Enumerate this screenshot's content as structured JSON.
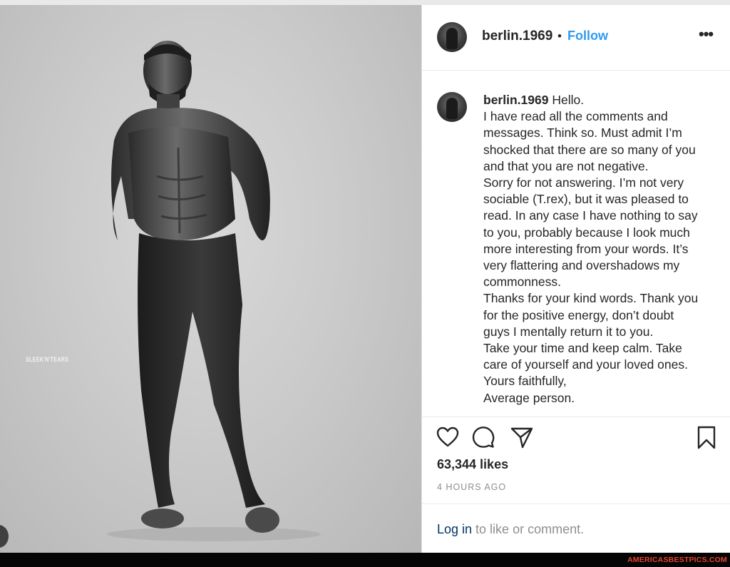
{
  "post": {
    "username": "berlin.1969",
    "separator": "•",
    "follow_label": "Follow",
    "more_label": "•••",
    "watermark": "SLEEK'N'TEARS",
    "caption_first": "Hello.",
    "caption_lines": [
      "I have read all the comments and",
      "messages. Think so. Must admit I’m",
      "shocked that there are so many of you",
      "and that you are not negative.",
      "Sorry for not answering. I’m not very",
      "sociable (T.rex), but it was pleased to",
      "read. In any case I have nothing to say",
      "to you, probably because I look much",
      "more interesting from your words. It’s",
      "very flattering and overshadows my",
      "commonness.",
      "Thanks for your kind words. Thank you",
      "for the positive energy, don’t doubt",
      "guys I mentally return it to you.",
      "Take your time and keep calm. Take",
      "care of yourself and your loved ones.",
      "Yours faithfully,",
      "Average person."
    ],
    "likes": "63,344 likes",
    "time_ago": "4 HOURS AGO",
    "login_link": "Log in",
    "login_suffix": " to like or comment."
  },
  "icons": {
    "like": "heart-icon",
    "comment": "comment-icon",
    "share": "paper-plane-icon",
    "save": "bookmark-icon",
    "more": "more-options-icon"
  },
  "colors": {
    "follow": "#2f9bf0",
    "login_link": "#003569",
    "meta_gray": "#8e8e8e",
    "site_tag": "#e8442e"
  },
  "footer": {
    "site_tag": "AMERICASBESTPICS.COM"
  }
}
